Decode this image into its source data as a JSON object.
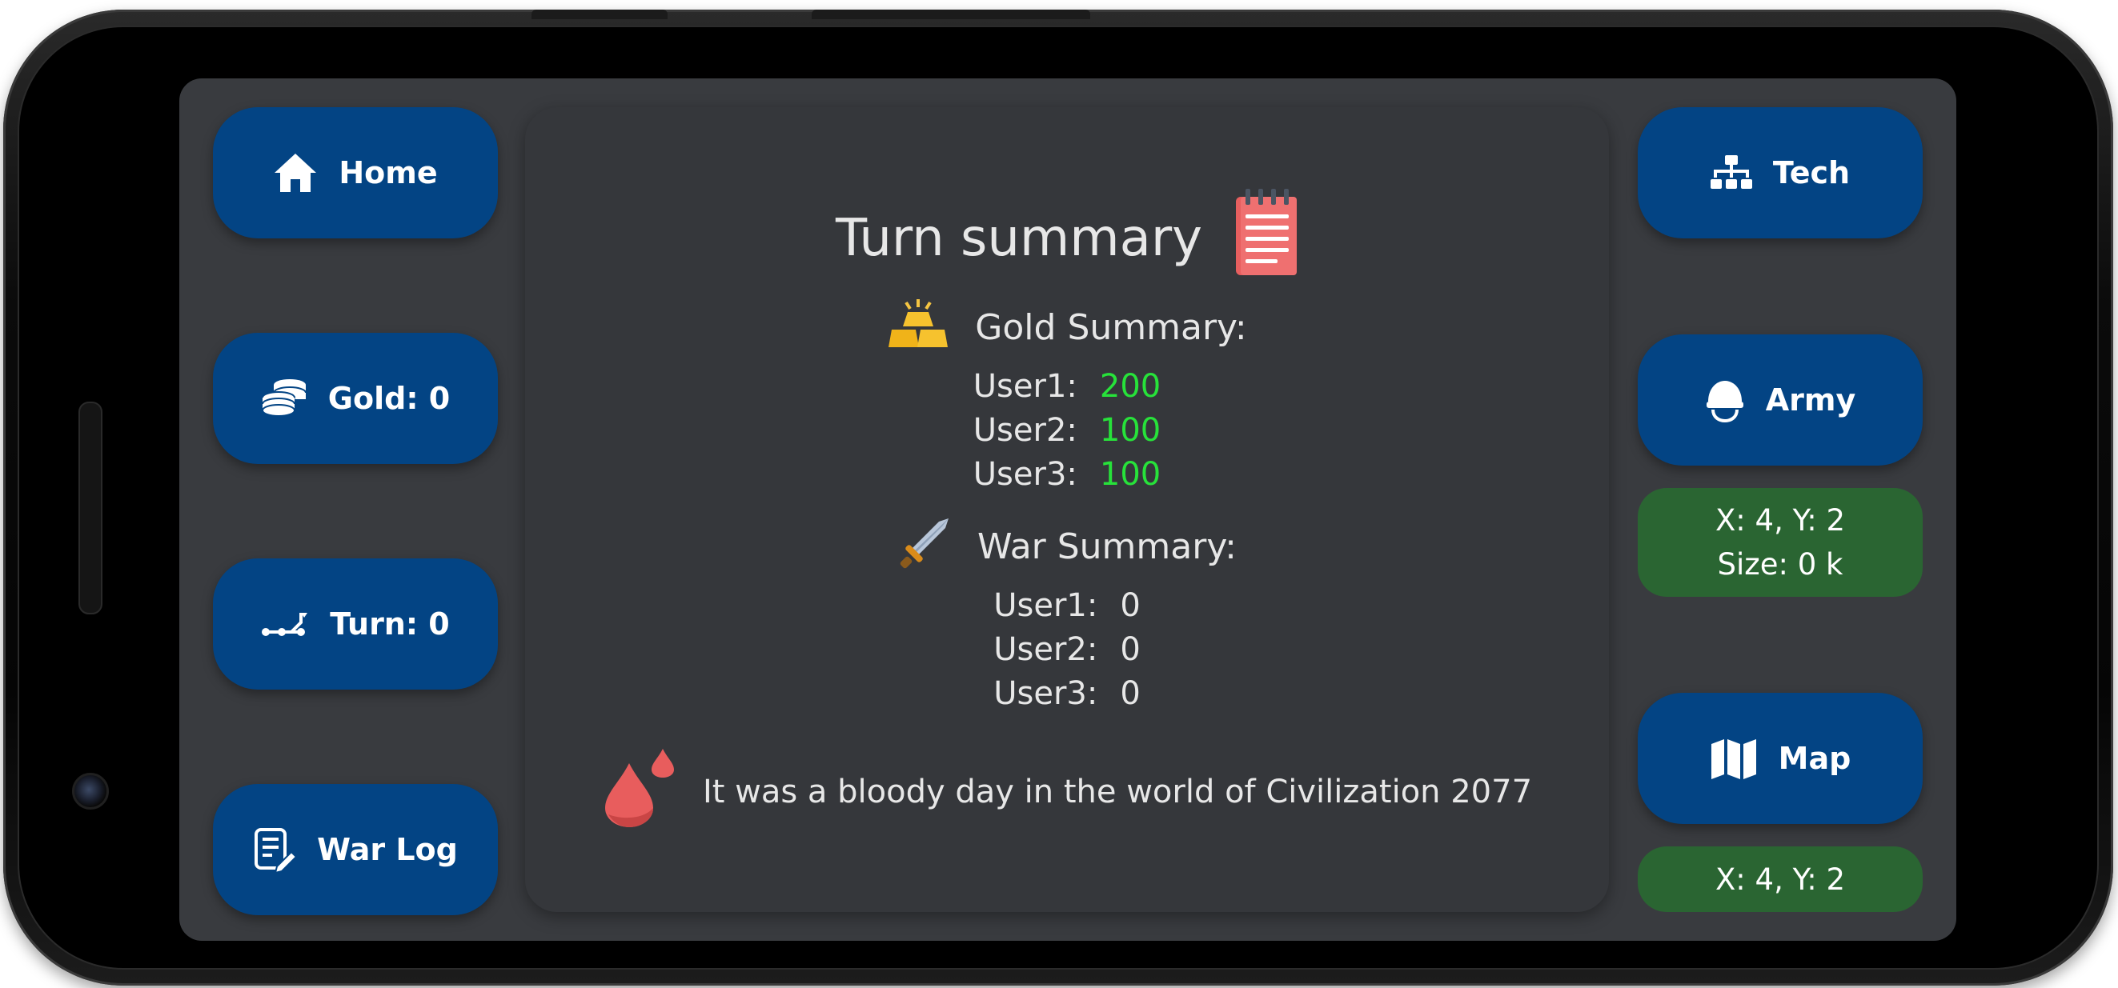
{
  "nav": {
    "home_label": "Home",
    "gold_label": "Gold: 0",
    "turn_label": "Turn: 0",
    "warlog_label": "War Log",
    "tech_label": "Tech",
    "army_label": "Army",
    "map_label": "Map"
  },
  "army_info": {
    "coords": "X: 4, Y: 2",
    "size": "Size: 0 k"
  },
  "map_info": {
    "coords": "X: 4, Y: 2"
  },
  "summary": {
    "title": "Turn summary",
    "gold": {
      "heading": "Gold Summary:",
      "rows": [
        {
          "user": "User1:",
          "value": "200"
        },
        {
          "user": "User2:",
          "value": "100"
        },
        {
          "user": "User3:",
          "value": "100"
        }
      ]
    },
    "war": {
      "heading": "War Summary:",
      "rows": [
        {
          "user": "User1:",
          "value": "0"
        },
        {
          "user": "User2:",
          "value": "0"
        },
        {
          "user": "User3:",
          "value": "0"
        }
      ]
    },
    "message": "It was a bloody day in the world of Civilization 2077"
  },
  "colors": {
    "button": "#034484",
    "coord_box": "#2a6532",
    "screen_bg": "#393b3f",
    "panel_bg": "#35373b",
    "gold_value": "#27e23a",
    "blood": "#e35b5b"
  },
  "icons": [
    "home-icon",
    "coins-icon",
    "turn-path-icon",
    "war-log-icon",
    "sitemap-icon",
    "helmet-icon",
    "map-icon",
    "notepad-icon",
    "gold-bars-icon",
    "sword-icon",
    "blood-drops-icon"
  ]
}
